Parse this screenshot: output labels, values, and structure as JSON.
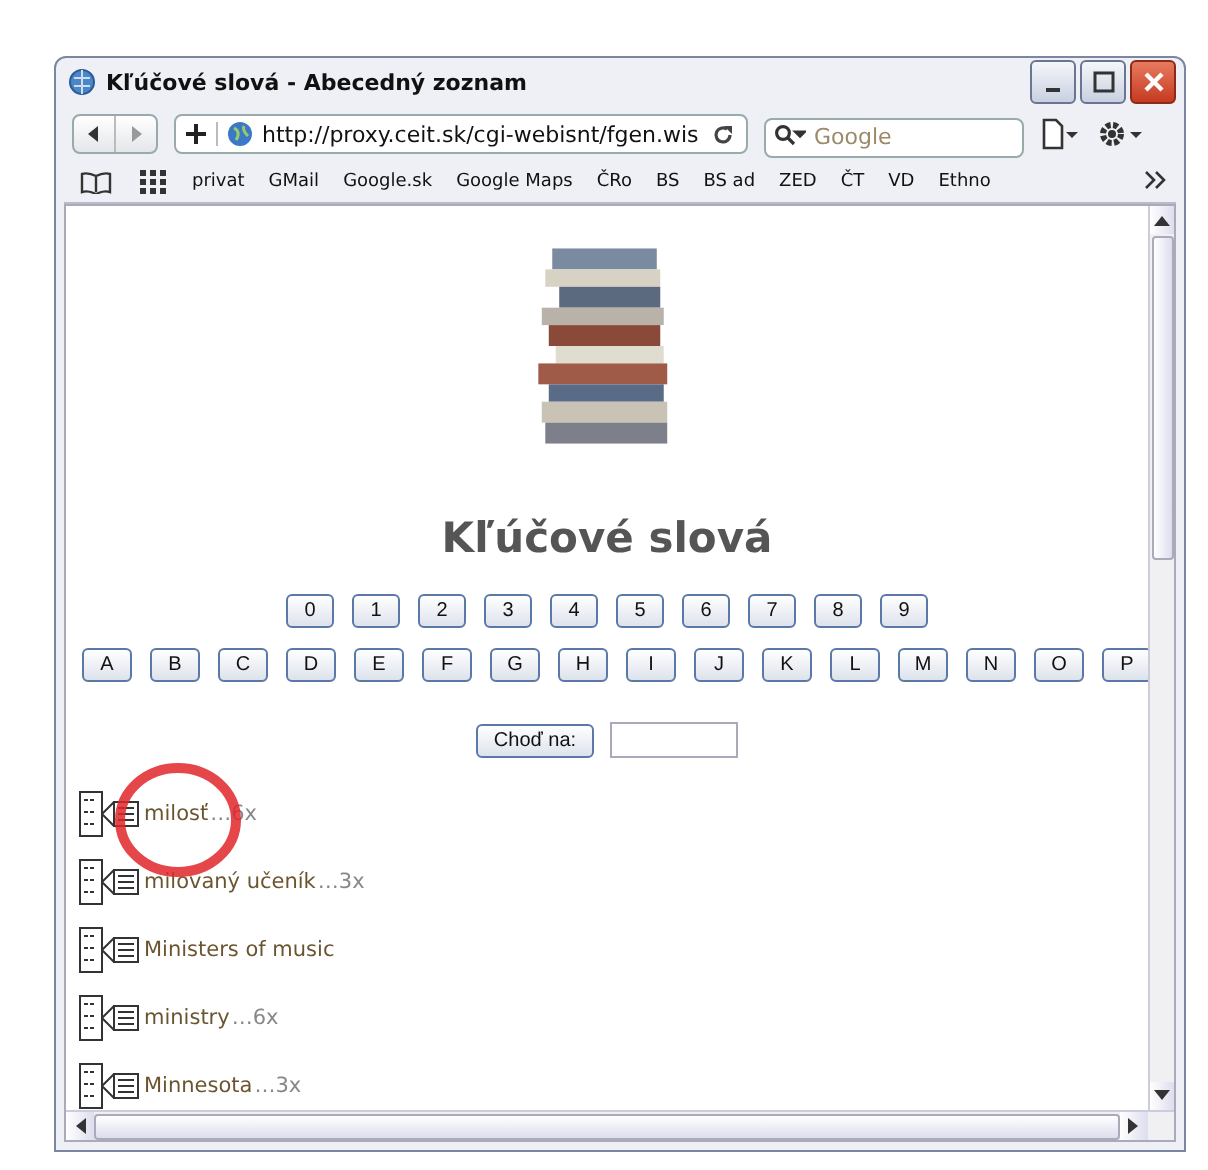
{
  "window": {
    "title": "Kľúčové slová - Abecedný zoznam"
  },
  "toolbar": {
    "url": "http://proxy.ceit.sk/cgi-webisnt/fgen.wis",
    "search": {
      "placeholder": "Google"
    }
  },
  "bookmarks": [
    "privat",
    "GMail",
    "Google.sk",
    "Google Maps",
    "ČRo",
    "BS",
    "BS ad",
    "ZED",
    "ČT",
    "VD",
    "Ethno"
  ],
  "page": {
    "heading": "Kľúčové slová",
    "digits": [
      "0",
      "1",
      "2",
      "3",
      "4",
      "5",
      "6",
      "7",
      "8",
      "9"
    ],
    "letters": [
      "A",
      "B",
      "C",
      "D",
      "E",
      "F",
      "G",
      "H",
      "I",
      "J",
      "K",
      "L",
      "M",
      "N",
      "O",
      "P"
    ],
    "goto_button": "Choď na:",
    "entries": [
      {
        "name": "milosť",
        "count": "…6x"
      },
      {
        "name": "milovaný učeník",
        "count": "…3x"
      },
      {
        "name": "Ministers of music"
      },
      {
        "name": "ministry",
        "count": "…6x"
      },
      {
        "name": "Minnesota",
        "count": "…3x"
      }
    ]
  }
}
